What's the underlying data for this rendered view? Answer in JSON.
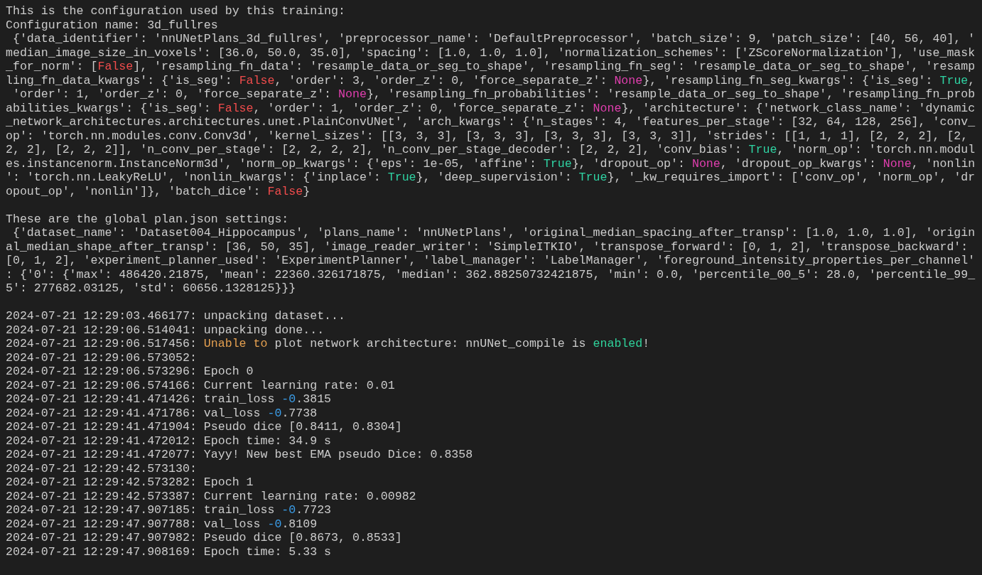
{
  "sections": [
    {
      "lines": [
        [
          {
            "kind": "text",
            "text": "This is the configuration used by this training:"
          }
        ],
        [
          {
            "kind": "text",
            "text": "Configuration name: 3d_fullres"
          }
        ],
        [
          {
            "kind": "text",
            "text": " {'data_identifier': 'nnUNetPlans_3d_fullres', 'preprocessor_name': 'DefaultPreprocessor', 'batch_size': 9, 'patch_size': [40, 56, 40], '"
          }
        ],
        [
          {
            "kind": "text",
            "text": "median_image_size_in_voxels': [36.0, 50.0, 35.0], 'spacing': [1.0, 1.0, 1.0], 'normalization_schemes': ['ZScoreNormalization'], 'use_mask"
          }
        ],
        [
          {
            "kind": "text",
            "text": "_for_norm': ["
          },
          {
            "kind": "false",
            "text": "False"
          },
          {
            "kind": "text",
            "text": "], 'resampling_fn_data': 'resample_data_or_seg_to_shape', 'resampling_fn_seg': 'resample_data_or_seg_to_shape', 'resamp"
          }
        ],
        [
          {
            "kind": "text",
            "text": "ling_fn_data_kwargs': {'is_seg': "
          },
          {
            "kind": "false",
            "text": "False"
          },
          {
            "kind": "text",
            "text": ", 'order': 3, 'order_z': 0, 'force_separate_z': "
          },
          {
            "kind": "none",
            "text": "None"
          },
          {
            "kind": "text",
            "text": "}, 'resampling_fn_seg_kwargs': {'is_seg': "
          },
          {
            "kind": "true",
            "text": "True"
          },
          {
            "kind": "text",
            "text": ","
          }
        ],
        [
          {
            "kind": "text",
            "text": " 'order': 1, 'order_z': 0, 'force_separate_z': "
          },
          {
            "kind": "none",
            "text": "None"
          },
          {
            "kind": "text",
            "text": "}, 'resampling_fn_probabilities': 'resample_data_or_seg_to_shape', 'resampling_fn_prob"
          }
        ],
        [
          {
            "kind": "text",
            "text": "abilities_kwargs': {'is_seg': "
          },
          {
            "kind": "false",
            "text": "False"
          },
          {
            "kind": "text",
            "text": ", 'order': 1, 'order_z': 0, 'force_separate_z': "
          },
          {
            "kind": "none",
            "text": "None"
          },
          {
            "kind": "text",
            "text": "}, 'architecture': {'network_class_name': 'dynamic"
          }
        ],
        [
          {
            "kind": "text",
            "text": "_network_architectures.architectures.unet.PlainConvUNet', 'arch_kwargs': {'n_stages': 4, 'features_per_stage': [32, 64, 128, 256], 'conv_"
          }
        ],
        [
          {
            "kind": "text",
            "text": "op': 'torch.nn.modules.conv.Conv3d', 'kernel_sizes': [[3, 3, 3], [3, 3, 3], [3, 3, 3], [3, 3, 3]], 'strides': [[1, 1, 1], [2, 2, 2], [2,"
          }
        ],
        [
          {
            "kind": "text",
            "text": "2, 2], [2, 2, 2]], 'n_conv_per_stage': [2, 2, 2, 2], 'n_conv_per_stage_decoder': [2, 2, 2], 'conv_bias': "
          },
          {
            "kind": "true",
            "text": "True"
          },
          {
            "kind": "text",
            "text": ", 'norm_op': 'torch.nn.modul"
          }
        ],
        [
          {
            "kind": "text",
            "text": "es.instancenorm.InstanceNorm3d', 'norm_op_kwargs': {'eps': 1e-05, 'affine': "
          },
          {
            "kind": "true",
            "text": "True"
          },
          {
            "kind": "text",
            "text": "}, 'dropout_op': "
          },
          {
            "kind": "none",
            "text": "None"
          },
          {
            "kind": "text",
            "text": ", 'dropout_op_kwargs': "
          },
          {
            "kind": "none",
            "text": "None"
          },
          {
            "kind": "text",
            "text": ", 'nonlin"
          }
        ],
        [
          {
            "kind": "text",
            "text": "': 'torch.nn.LeakyReLU', 'nonlin_kwargs': {'inplace': "
          },
          {
            "kind": "true",
            "text": "True"
          },
          {
            "kind": "text",
            "text": "}, 'deep_supervision': "
          },
          {
            "kind": "true",
            "text": "True"
          },
          {
            "kind": "text",
            "text": "}, '_kw_requires_import': ['conv_op', 'norm_op', 'dr"
          }
        ],
        [
          {
            "kind": "text",
            "text": "opout_op', 'nonlin']}, 'batch_dice': "
          },
          {
            "kind": "false",
            "text": "False"
          },
          {
            "kind": "text",
            "text": "}"
          }
        ]
      ]
    },
    {
      "lines": [
        [
          {
            "kind": "text",
            "text": "These are the global plan.json settings:"
          }
        ],
        [
          {
            "kind": "text",
            "text": " {'dataset_name': 'Dataset004_Hippocampus', 'plans_name': 'nnUNetPlans', 'original_median_spacing_after_transp': [1.0, 1.0, 1.0], 'origin"
          }
        ],
        [
          {
            "kind": "text",
            "text": "al_median_shape_after_transp': [36, 50, 35], 'image_reader_writer': 'SimpleITKIO', 'transpose_forward': [0, 1, 2], 'transpose_backward':"
          }
        ],
        [
          {
            "kind": "text",
            "text": "[0, 1, 2], 'experiment_planner_used': 'ExperimentPlanner', 'label_manager': 'LabelManager', 'foreground_intensity_properties_per_channel'"
          }
        ],
        [
          {
            "kind": "text",
            "text": ": {'0': {'max': 486420.21875, 'mean': 22360.326171875, 'median': 362.88250732421875, 'min': 0.0, 'percentile_00_5': 28.0, 'percentile_99_"
          }
        ],
        [
          {
            "kind": "text",
            "text": "5': 277682.03125, 'std': 60656.1328125}}}"
          }
        ]
      ]
    },
    {
      "lines": [
        [
          {
            "kind": "text",
            "text": "2024-07-21 12:29:03.466177: unpacking dataset..."
          }
        ],
        [
          {
            "kind": "text",
            "text": "2024-07-21 12:29:06.514041: unpacking done..."
          }
        ],
        [
          {
            "kind": "text",
            "text": "2024-07-21 12:29:06.517456: "
          },
          {
            "kind": "warn",
            "text": "Unable to"
          },
          {
            "kind": "text",
            "text": " plot network architecture: nnUNet_compile is "
          },
          {
            "kind": "ok",
            "text": "enabled"
          },
          {
            "kind": "text",
            "text": "!"
          }
        ],
        [
          {
            "kind": "text",
            "text": "2024-07-21 12:29:06.573052:"
          }
        ],
        [
          {
            "kind": "text",
            "text": "2024-07-21 12:29:06.573296: Epoch 0"
          }
        ],
        [
          {
            "kind": "text",
            "text": "2024-07-21 12:29:06.574166: Current learning rate: 0.01"
          }
        ],
        [
          {
            "kind": "text",
            "text": "2024-07-21 12:29:41.471426: train_loss "
          },
          {
            "kind": "number",
            "text": "-0"
          },
          {
            "kind": "text",
            "text": ".3815"
          }
        ],
        [
          {
            "kind": "text",
            "text": "2024-07-21 12:29:41.471786: val_loss "
          },
          {
            "kind": "number",
            "text": "-0"
          },
          {
            "kind": "text",
            "text": ".7738"
          }
        ],
        [
          {
            "kind": "text",
            "text": "2024-07-21 12:29:41.471904: Pseudo dice [0.8411, 0.8304]"
          }
        ],
        [
          {
            "kind": "text",
            "text": "2024-07-21 12:29:41.472012: Epoch time: 34.9 s"
          }
        ],
        [
          {
            "kind": "text",
            "text": "2024-07-21 12:29:41.472077: Yayy! New best EMA pseudo Dice: 0.8358"
          }
        ],
        [
          {
            "kind": "text",
            "text": "2024-07-21 12:29:42.573130:"
          }
        ],
        [
          {
            "kind": "text",
            "text": "2024-07-21 12:29:42.573282: Epoch 1"
          }
        ],
        [
          {
            "kind": "text",
            "text": "2024-07-21 12:29:42.573387: Current learning rate: 0.00982"
          }
        ],
        [
          {
            "kind": "text",
            "text": "2024-07-21 12:29:47.907185: train_loss "
          },
          {
            "kind": "number",
            "text": "-0"
          },
          {
            "kind": "text",
            "text": ".7723"
          }
        ],
        [
          {
            "kind": "text",
            "text": "2024-07-21 12:29:47.907788: val_loss "
          },
          {
            "kind": "number",
            "text": "-0"
          },
          {
            "kind": "text",
            "text": ".8109"
          }
        ],
        [
          {
            "kind": "text",
            "text": "2024-07-21 12:29:47.907982: Pseudo dice [0.8673, 0.8533]"
          }
        ],
        [
          {
            "kind": "text",
            "text": "2024-07-21 12:29:47.908169: Epoch time: 5.33 s"
          }
        ]
      ]
    }
  ]
}
